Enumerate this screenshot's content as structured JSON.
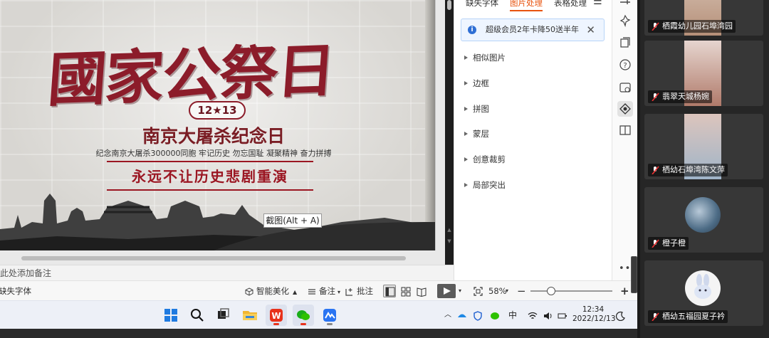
{
  "slide": {
    "title": "國家公祭日",
    "date_badge": "12★13",
    "subtitle": "南京大屠杀纪念日",
    "tagline": "纪念南京大屠杀300000同胞  牢记历史  勿忘国耻  凝聚精神  奋力拼搏",
    "slogan": "永远不让历史悲剧重演"
  },
  "screenshot_tooltip": "截图(Alt + A)",
  "notes_placeholder": "击此处添加备注",
  "statusbar": {
    "missing_font": "缺失字体",
    "beautify": "智能美化",
    "notes": "备注",
    "comment": "批注",
    "zoom": "58%",
    "minus": "−",
    "plus": "+"
  },
  "panel": {
    "tabs": [
      "缺失字体",
      "图片处理",
      "表格处理"
    ],
    "active_tab": 1,
    "menu_icon": "menu-icon",
    "notice": "超级会员2年卡降50送半年",
    "items": [
      "相似图片",
      "边框",
      "拼图",
      "蒙层",
      "创意裁剪",
      "局部突出"
    ]
  },
  "taskbar": {
    "tray_lang": "中",
    "time": "12:34",
    "date": "2022/12/13"
  },
  "participants": [
    {
      "name": "栖霞幼儿园石埠湾园"
    },
    {
      "name": "翡翠天城杨婉"
    },
    {
      "name": "栖幼石埠湾陈文萍"
    },
    {
      "name": "橙子橙"
    },
    {
      "name": "栖幼五福园夏子衿"
    }
  ],
  "colors": {
    "accent": "#e8530e",
    "title_red": "#8c1c2a",
    "notice_blue": "#2f6fd4"
  }
}
